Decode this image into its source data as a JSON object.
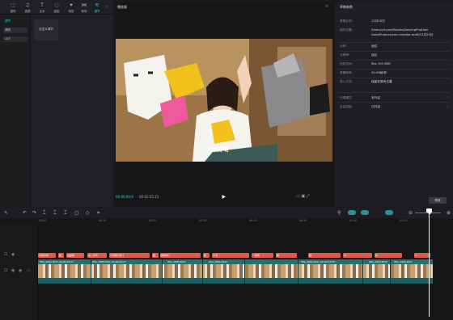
{
  "toolbar": {
    "items": [
      {
        "label": "媒体",
        "icon": "media-icon"
      },
      {
        "label": "音频",
        "icon": "audio-icon"
      },
      {
        "label": "文本",
        "icon": "text-icon"
      },
      {
        "label": "贴纸",
        "icon": "sticker-icon"
      },
      {
        "label": "特效",
        "icon": "effects-icon"
      },
      {
        "label": "转场",
        "icon": "transition-icon"
      },
      {
        "label": "调节",
        "icon": "adjust-icon"
      }
    ]
  },
  "left_nav": {
    "items": [
      "我的",
      "LUT"
    ],
    "active": "调节"
  },
  "adjust_card": "自定义调节",
  "player": {
    "title": "播放器",
    "time_current": "00:00:00:0",
    "time_total": "00:02:55:15",
    "caption": "大家好呀"
  },
  "props": {
    "title": "草稿参数",
    "rows": [
      {
        "label": "草稿名称:",
        "value": "12月20日"
      },
      {
        "label": "保存位置:",
        "value": "/Users/yinyan/Movies/JianyingPro/User Data/Projects/com.lveditor.draft/12月20日"
      },
      {
        "label": "比例:",
        "value": "适应"
      },
      {
        "label": "分辨率:",
        "value": "适应"
      },
      {
        "label": "色彩空间:",
        "value": "Rec.709 SDR"
      },
      {
        "label": "草稿帧率:",
        "value": "30.00帧/秒"
      },
      {
        "label": "导入方式:",
        "value": "保留在原有位置"
      },
      {
        "label": "代理模式:",
        "value": "未开启"
      },
      {
        "label": "自由层级:",
        "value": "已开启"
      }
    ],
    "edit": "修改"
  },
  "timeline": {
    "ticks": [
      "00:00",
      "00:10",
      "00:20",
      "00:30",
      "00:40",
      "00:50",
      "01:00",
      "01:10",
      "01:20"
    ],
    "text_clips": [
      "大家好呀",
      "我",
      "这是我",
      "在二次元",
      "今天我们去了",
      "被送到了",
      "我",
      "想",
      "今天",
      "一起吃",
      "被",
      "我",
      "大",
      "好",
      "1"
    ],
    "video_clips": [
      "IMG_2691.MOV  00:00:04:01",
      "IMG_2888.MOV  00:00:06:07",
      "IMG_2889.MOV",
      "IMG_2890.MOV",
      "IMG_2890.MOV  00:00:04:05",
      "IMG_2893.MOV",
      "IMG_2890.MOV"
    ]
  }
}
